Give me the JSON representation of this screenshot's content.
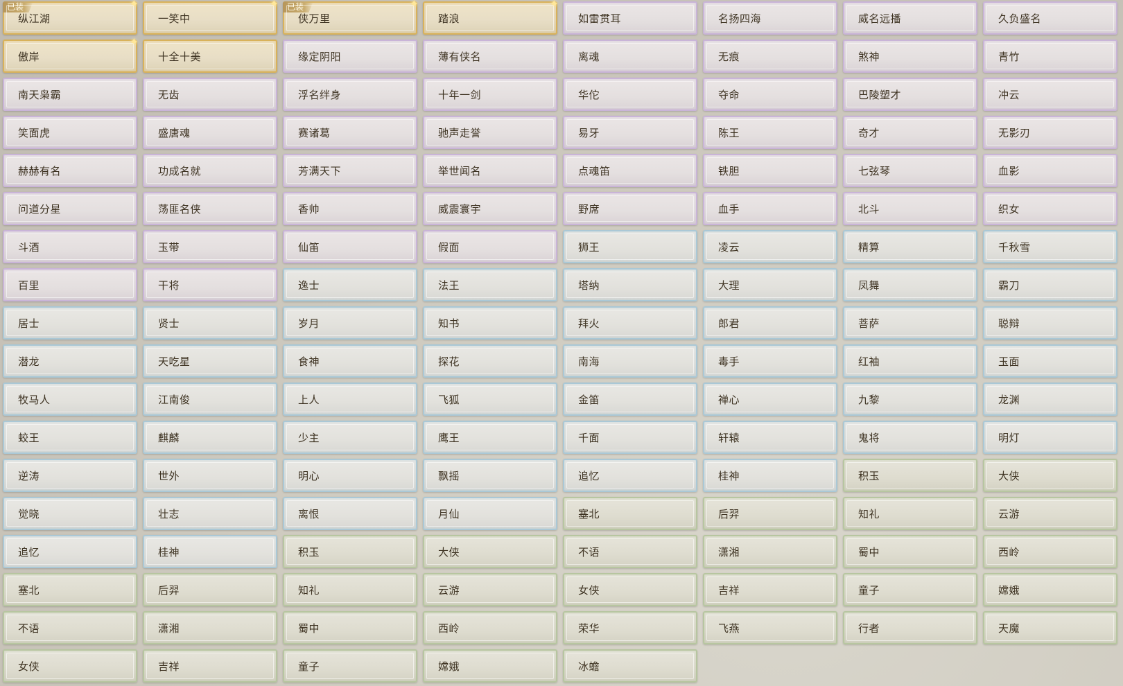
{
  "equipped_badge": "已装",
  "tiles": [
    {
      "label": "纵江湖",
      "tier": "gold",
      "equipped": true,
      "sparkle": true
    },
    {
      "label": "一笑中",
      "tier": "gold",
      "equipped": false,
      "sparkle": true
    },
    {
      "label": "侠万里",
      "tier": "gold",
      "equipped": true,
      "sparkle": true
    },
    {
      "label": "踏浪",
      "tier": "gold",
      "equipped": false,
      "sparkle": true
    },
    {
      "label": "如雷贯耳",
      "tier": "purple"
    },
    {
      "label": "名扬四海",
      "tier": "purple"
    },
    {
      "label": "威名远播",
      "tier": "purple"
    },
    {
      "label": "久负盛名",
      "tier": "purple"
    },
    {
      "label": "傲岸",
      "tier": "gold",
      "equipped": false,
      "sparkle": true
    },
    {
      "label": "十全十美",
      "tier": "gold"
    },
    {
      "label": "缘定阴阳",
      "tier": "purple"
    },
    {
      "label": "薄有侠名",
      "tier": "purple"
    },
    {
      "label": "离魂",
      "tier": "purple"
    },
    {
      "label": "无痕",
      "tier": "purple"
    },
    {
      "label": "煞神",
      "tier": "purple"
    },
    {
      "label": "青竹",
      "tier": "purple"
    },
    {
      "label": "南天枭霸",
      "tier": "purple"
    },
    {
      "label": "无齿",
      "tier": "purple"
    },
    {
      "label": "浮名绊身",
      "tier": "purple"
    },
    {
      "label": "十年一剑",
      "tier": "purple"
    },
    {
      "label": "华佗",
      "tier": "purple"
    },
    {
      "label": "夺命",
      "tier": "purple"
    },
    {
      "label": "巴陵塑才",
      "tier": "purple"
    },
    {
      "label": "冲云",
      "tier": "purple"
    },
    {
      "label": "笑面虎",
      "tier": "purple"
    },
    {
      "label": "盛唐魂",
      "tier": "purple"
    },
    {
      "label": "赛诸葛",
      "tier": "purple"
    },
    {
      "label": "驰声走誉",
      "tier": "purple"
    },
    {
      "label": "易牙",
      "tier": "purple"
    },
    {
      "label": "陈王",
      "tier": "purple"
    },
    {
      "label": "奇才",
      "tier": "purple"
    },
    {
      "label": "无影刃",
      "tier": "purple"
    },
    {
      "label": "赫赫有名",
      "tier": "purple"
    },
    {
      "label": "功成名就",
      "tier": "purple"
    },
    {
      "label": "芳满天下",
      "tier": "purple"
    },
    {
      "label": "举世闻名",
      "tier": "purple"
    },
    {
      "label": "点魂笛",
      "tier": "purple"
    },
    {
      "label": "铁胆",
      "tier": "purple"
    },
    {
      "label": "七弦琴",
      "tier": "purple"
    },
    {
      "label": "血影",
      "tier": "purple"
    },
    {
      "label": "问道分星",
      "tier": "purple"
    },
    {
      "label": "荡匪名侠",
      "tier": "purple"
    },
    {
      "label": "香帅",
      "tier": "purple"
    },
    {
      "label": "威震寰宇",
      "tier": "purple"
    },
    {
      "label": "野席",
      "tier": "purple"
    },
    {
      "label": "血手",
      "tier": "purple"
    },
    {
      "label": "北斗",
      "tier": "purple"
    },
    {
      "label": "织女",
      "tier": "purple"
    },
    {
      "label": "斗酒",
      "tier": "purple"
    },
    {
      "label": "玉带",
      "tier": "purple"
    },
    {
      "label": "仙笛",
      "tier": "purple"
    },
    {
      "label": "假面",
      "tier": "purple"
    },
    {
      "label": "狮王",
      "tier": "blue"
    },
    {
      "label": "凌云",
      "tier": "blue"
    },
    {
      "label": "精算",
      "tier": "blue"
    },
    {
      "label": "千秋雪",
      "tier": "blue"
    },
    {
      "label": "百里",
      "tier": "purple"
    },
    {
      "label": "干将",
      "tier": "purple"
    },
    {
      "label": "逸士",
      "tier": "blue"
    },
    {
      "label": "法王",
      "tier": "blue"
    },
    {
      "label": "塔纳",
      "tier": "blue"
    },
    {
      "label": "大理",
      "tier": "blue"
    },
    {
      "label": "凤舞",
      "tier": "blue"
    },
    {
      "label": "霸刀",
      "tier": "blue"
    },
    {
      "label": "居士",
      "tier": "blue"
    },
    {
      "label": "贤士",
      "tier": "blue"
    },
    {
      "label": "岁月",
      "tier": "blue"
    },
    {
      "label": "知书",
      "tier": "blue"
    },
    {
      "label": "拜火",
      "tier": "blue"
    },
    {
      "label": "郎君",
      "tier": "blue"
    },
    {
      "label": "菩萨",
      "tier": "blue"
    },
    {
      "label": "聪辩",
      "tier": "blue"
    },
    {
      "label": "潜龙",
      "tier": "blue"
    },
    {
      "label": "天吃星",
      "tier": "blue"
    },
    {
      "label": "食神",
      "tier": "blue"
    },
    {
      "label": "探花",
      "tier": "blue"
    },
    {
      "label": "南海",
      "tier": "blue"
    },
    {
      "label": "毒手",
      "tier": "blue"
    },
    {
      "label": "红袖",
      "tier": "blue"
    },
    {
      "label": "玉面",
      "tier": "blue"
    },
    {
      "label": "牧马人",
      "tier": "blue"
    },
    {
      "label": "江南俊",
      "tier": "blue"
    },
    {
      "label": "上人",
      "tier": "blue"
    },
    {
      "label": "飞狐",
      "tier": "blue"
    },
    {
      "label": "金笛",
      "tier": "blue"
    },
    {
      "label": "禅心",
      "tier": "blue"
    },
    {
      "label": "九黎",
      "tier": "blue"
    },
    {
      "label": "龙渊",
      "tier": "blue"
    },
    {
      "label": "蛟王",
      "tier": "blue"
    },
    {
      "label": "麒麟",
      "tier": "blue"
    },
    {
      "label": "少主",
      "tier": "blue"
    },
    {
      "label": "鹰王",
      "tier": "blue"
    },
    {
      "label": "千面",
      "tier": "blue"
    },
    {
      "label": "轩辕",
      "tier": "blue"
    },
    {
      "label": "鬼将",
      "tier": "blue"
    },
    {
      "label": "明灯",
      "tier": "blue"
    },
    {
      "label": "逆涛",
      "tier": "blue"
    },
    {
      "label": "世外",
      "tier": "blue"
    },
    {
      "label": "明心",
      "tier": "blue"
    },
    {
      "label": "飘摇",
      "tier": "blue"
    },
    {
      "label": "追忆",
      "tier": "blue"
    },
    {
      "label": "桂神",
      "tier": "blue"
    },
    {
      "label": "积玉",
      "tier": "green"
    },
    {
      "label": "大侠",
      "tier": "green"
    },
    {
      "label": "觉晓",
      "tier": "blue"
    },
    {
      "label": "壮志",
      "tier": "blue"
    },
    {
      "label": "离恨",
      "tier": "blue"
    },
    {
      "label": "月仙",
      "tier": "blue"
    },
    {
      "label": "塞北",
      "tier": "green"
    },
    {
      "label": "后羿",
      "tier": "green"
    },
    {
      "label": "知礼",
      "tier": "green"
    },
    {
      "label": "云游",
      "tier": "green"
    },
    {
      "label": "追忆",
      "tier": "blue"
    },
    {
      "label": "桂神",
      "tier": "blue"
    },
    {
      "label": "积玉",
      "tier": "green"
    },
    {
      "label": "大侠",
      "tier": "green"
    },
    {
      "label": "不语",
      "tier": "green"
    },
    {
      "label": "潇湘",
      "tier": "green"
    },
    {
      "label": "蜀中",
      "tier": "green"
    },
    {
      "label": "西岭",
      "tier": "green"
    },
    {
      "label": "塞北",
      "tier": "green"
    },
    {
      "label": "后羿",
      "tier": "green"
    },
    {
      "label": "知礼",
      "tier": "green"
    },
    {
      "label": "云游",
      "tier": "green"
    },
    {
      "label": "女侠",
      "tier": "green"
    },
    {
      "label": "吉祥",
      "tier": "green"
    },
    {
      "label": "童子",
      "tier": "green"
    },
    {
      "label": "嫦娥",
      "tier": "green"
    },
    {
      "label": "不语",
      "tier": "green"
    },
    {
      "label": "潇湘",
      "tier": "green"
    },
    {
      "label": "蜀中",
      "tier": "green"
    },
    {
      "label": "西岭",
      "tier": "green"
    },
    {
      "label": "荣华",
      "tier": "green"
    },
    {
      "label": "飞燕",
      "tier": "green"
    },
    {
      "label": "行者",
      "tier": "green"
    },
    {
      "label": "天魔",
      "tier": "green"
    },
    {
      "label": "女侠",
      "tier": "green"
    },
    {
      "label": "吉祥",
      "tier": "green"
    },
    {
      "label": "童子",
      "tier": "green"
    },
    {
      "label": "嫦娥",
      "tier": "green"
    },
    {
      "label": "冰蟾",
      "tier": "green"
    }
  ]
}
